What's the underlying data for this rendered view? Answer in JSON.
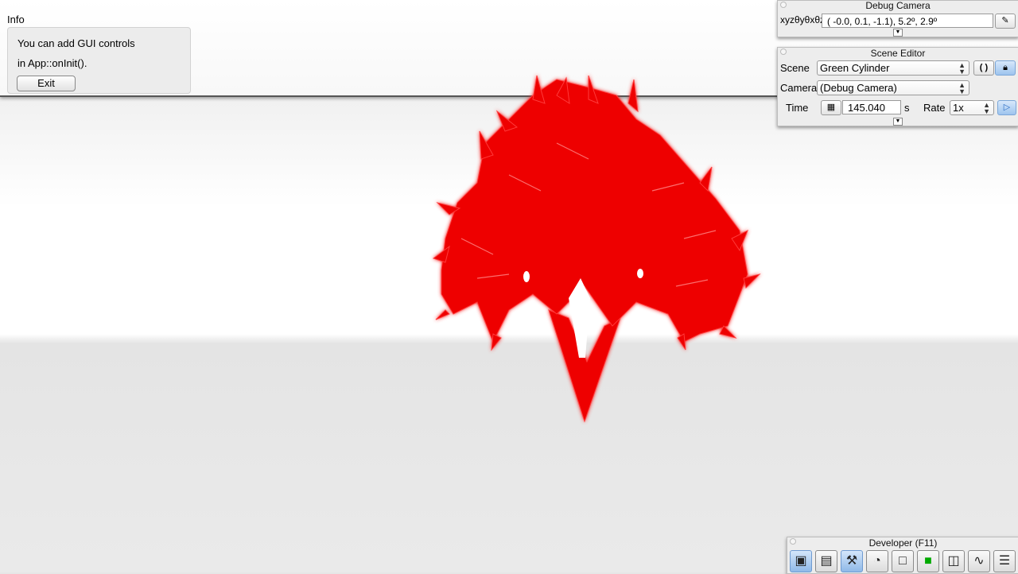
{
  "info": {
    "title": "Info",
    "line1": "You can add GUI controls",
    "line2": "in App::onInit().",
    "exit_label": "Exit"
  },
  "debug_camera": {
    "title": "Debug Camera",
    "coord_label": "xyzθyθxθz",
    "coord_value": "( -0.0,   0.1,  -1.1),   5.2º,   2.9º"
  },
  "scene_editor": {
    "title": "Scene Editor",
    "scene_label": "Scene",
    "scene_value": "Green Cylinder",
    "camera_label": "Camera",
    "camera_value": "(Debug Camera)",
    "time_label": "Time",
    "time_value": "145.040",
    "time_unit": "s",
    "rate_label": "Rate",
    "rate_value": "1x"
  },
  "developer": {
    "title": "Developer (F11)",
    "tools": [
      "camera-icon",
      "clapperboard-icon",
      "tools-icon",
      "clock-icon",
      "note-icon",
      "terminal-icon",
      "windows-icon",
      "graph-monitor-icon",
      "document-icon"
    ]
  },
  "colors": {
    "tree_red": "#ee0000",
    "accent_blue": "#8fb9e8"
  }
}
